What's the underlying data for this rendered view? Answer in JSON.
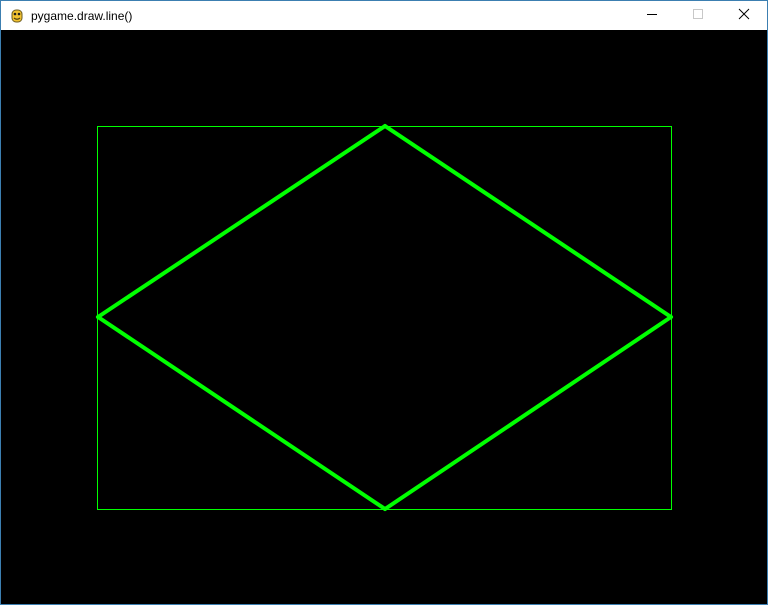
{
  "window": {
    "title": "pygame.draw.line()",
    "icon": "pygame-snake-icon",
    "controls": {
      "minimize": "minimize-icon",
      "maximize": "maximize-icon",
      "close": "close-icon"
    }
  },
  "scene": {
    "background_color": "#000000",
    "line_color": "#00ff00",
    "rectangle": "thin green rectangle outline",
    "diamond": "thick green diamond connecting the rectangle edge midpoints"
  }
}
